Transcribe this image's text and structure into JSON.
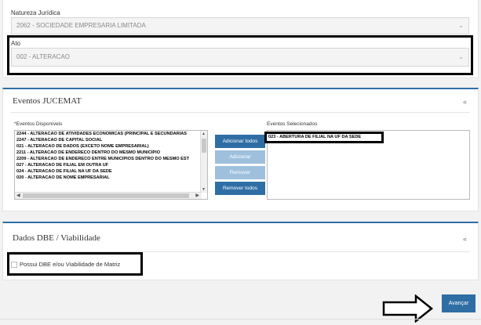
{
  "natureza": {
    "label": "Natureza Jurídica",
    "value": "2062 - SOCIEDADE EMPRESARIA LIMITADA"
  },
  "ato": {
    "label": "Ato",
    "value": "002 - ALTERACAO"
  },
  "eventos": {
    "title": "Eventos JUCEMAT",
    "collapse": "«",
    "disponiveis_label": "*Eventos Disponíveis",
    "selecionados_label": "Eventos Selecionados",
    "disponiveis": [
      "2244 - ALTERACAO DE ATIVIDADES ECONOMICAS (PRINCIPAL E SECUNDARIAS",
      "2247 - ALTERACAO DE CAPITAL SOCIAL",
      "021 - ALTERACAO DE DADOS (EXCETO NOME EMPRESARIAL)",
      "2211 - ALTERACAO DE ENDERECO DENTRO DO MESMO MUNICIPIO",
      "2209 - ALTERACAO DE ENDERECO ENTRE MUNICIPIOS DENTRO DO MESMO EST",
      "027 - ALTERACAO DE FILIAL EM OUTRA UF",
      "024 - ALTERACAO DE FILIAL NA UF DA SEDE",
      "020 - ALTERACAO DE NOME EMPRESARIAL"
    ],
    "selecionados": [
      "023 - ABERTURA DE FILIAL NA UF DA SEDE"
    ],
    "buttons": {
      "adicionar_todos": "Adicionar todos",
      "adicionar": "Adicionar",
      "remover": "Remover",
      "remover_todos": "Remover todos"
    }
  },
  "dbe": {
    "title": "Dados DBE / Viabilidade",
    "collapse": "«",
    "checkbox_label": "Possui DBE e/ou Viabilidade de Matriz"
  },
  "footer": {
    "avancar": "Avançar"
  },
  "colors": {
    "accent": "#2f6ea5",
    "disabled": "#9ec0dd"
  }
}
